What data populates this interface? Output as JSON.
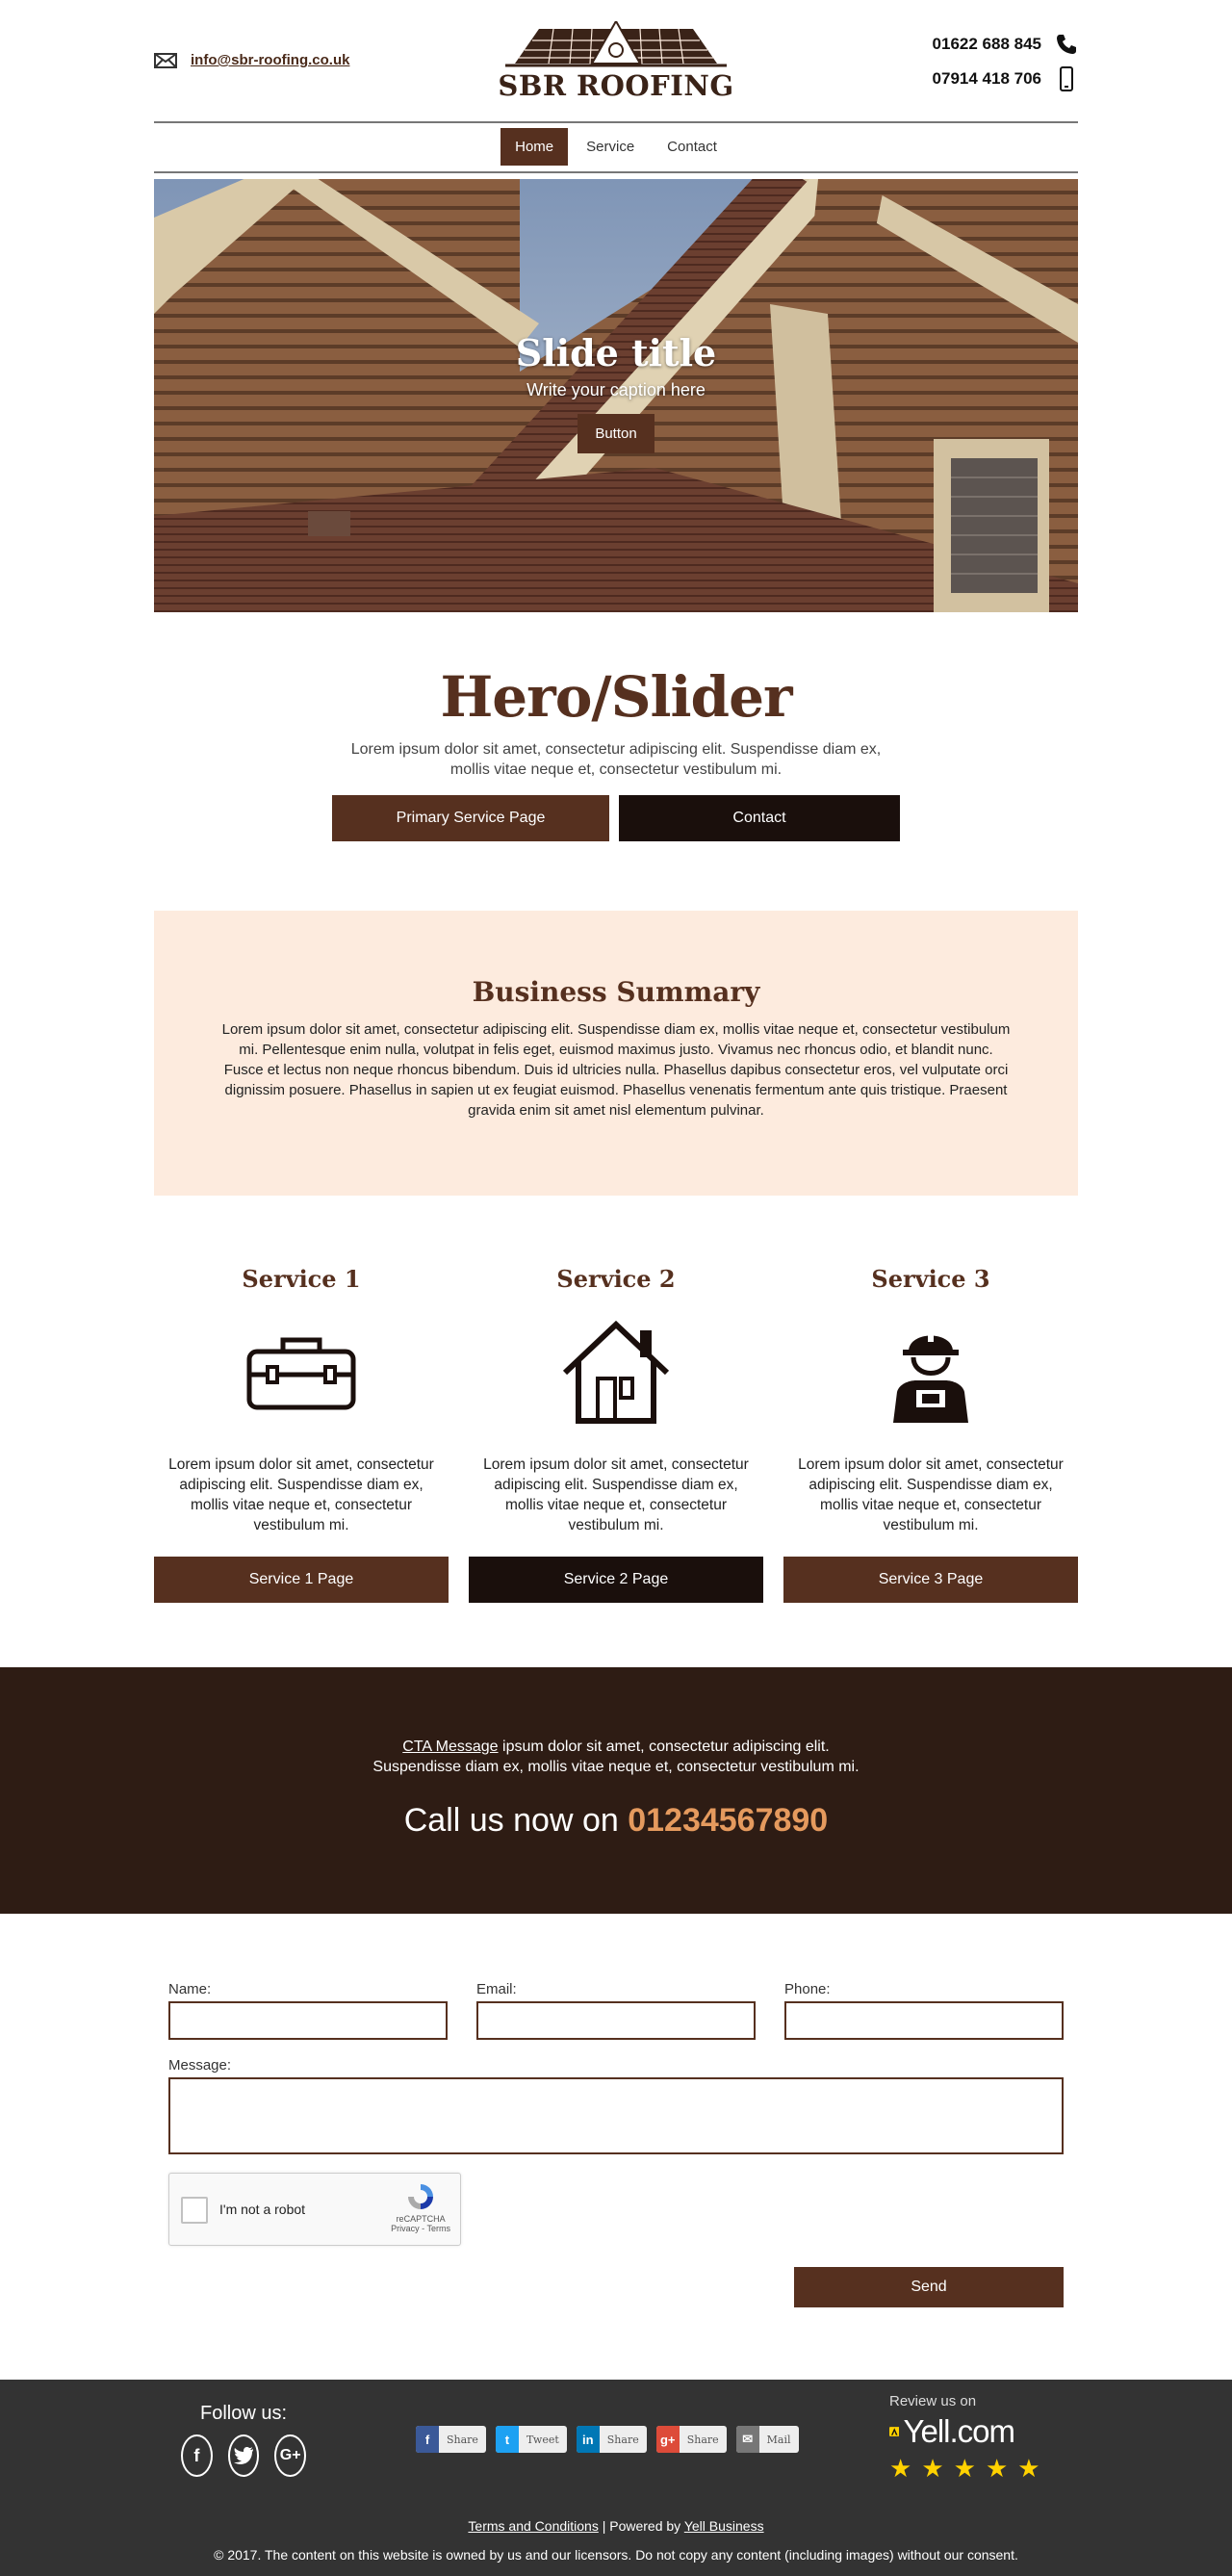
{
  "header": {
    "email": "info@sbr-roofing.co.uk",
    "logo_text": "SBR ROOFING",
    "phone_1": "01622 688 845",
    "phone_2": "07914 418 706"
  },
  "nav": {
    "items": [
      "Home",
      "Service",
      "Contact"
    ]
  },
  "slider": {
    "title": "Slide title",
    "caption": "Write your caption here",
    "button": "Button"
  },
  "intro": {
    "title": "Hero/Slider",
    "text": "Lorem ipsum dolor sit amet, consectetur adipiscing elit. Suspendisse diam ex, mollis vitae neque et, consectetur vestibulum mi.",
    "primary_button": "Primary Service Page",
    "contact_button": "Contact"
  },
  "summary": {
    "title": "Business Summary",
    "text": "Lorem ipsum dolor sit amet, consectetur adipiscing elit. Suspendisse diam ex, mollis vitae neque et, consectetur vestibulum mi. Pellentesque enim nulla, volutpat in felis eget, euismod maximus justo. Vivamus nec rhoncus odio, et blandit nunc. Fusce et lectus non neque rhoncus bibendum. Duis id ultricies nulla. Phasellus dapibus consectetur eros, vel vulputate orci dignissim posuere. Phasellus in sapien ut ex feugiat euismod. Phasellus venenatis fermentum ante quis tristique. Praesent gravida enim sit amet nisl elementum pulvinar."
  },
  "services": [
    {
      "title": "Service 1",
      "icon": "toolbox-icon",
      "text": "Lorem ipsum dolor sit amet, consectetur adipiscing elit. Suspendisse diam ex, mollis vitae neque et, consectetur vestibulum mi.",
      "button": "Service 1 Page"
    },
    {
      "title": "Service 2",
      "icon": "house-icon",
      "text": "Lorem ipsum dolor sit amet, consectetur adipiscing elit. Suspendisse diam ex, mollis vitae neque et, consectetur vestibulum mi.",
      "button": "Service 2 Page"
    },
    {
      "title": "Service 3",
      "icon": "worker-icon",
      "text": "Lorem ipsum dolor sit amet, consectetur adipiscing elit. Suspendisse diam ex, mollis vitae neque et, consectetur vestibulum mi.",
      "button": "Service 3 Page"
    }
  ],
  "cta": {
    "link": "CTA Message",
    "line_1": " ipsum dolor sit amet, consectetur adipiscing elit.",
    "line_2": "Suspendisse diam ex, mollis vitae neque et, consectetur vestibulum mi.",
    "call_prefix": "Call us now on ",
    "call_number": "01234567890"
  },
  "form": {
    "name_label": "Name:",
    "email_label": "Email:",
    "phone_label": "Phone:",
    "message_label": "Message:",
    "captcha_label": "I'm not a robot",
    "captcha_brand": "reCAPTCHA",
    "captcha_terms": "Privacy - Terms",
    "send": "Send"
  },
  "footer": {
    "follow": "Follow us:",
    "shares": [
      {
        "glyph": "f",
        "label": "Share",
        "color": "#3b5998"
      },
      {
        "glyph": "t",
        "label": "Tweet",
        "color": "#1da1f2"
      },
      {
        "glyph": "in",
        "label": "Share",
        "color": "#0077b5"
      },
      {
        "glyph": "g+",
        "label": "Share",
        "color": "#dd4b39"
      },
      {
        "glyph": "✉",
        "label": "Mail",
        "color": "#777777"
      }
    ],
    "review": "Review us on",
    "yell": "Yell.com",
    "terms": "Terms and Conditions",
    "powered_prefix": " | Powered by ",
    "powered": "Yell Business",
    "copyright": "© 2017. The content on this website is owned by us and our licensors. Do not copy any content (including images) without our consent."
  },
  "colors": {
    "brand_brown": "#56301f",
    "dark": "#1a0f0c",
    "summary_bg": "#fdebde",
    "accent_orange": "#e59a5e"
  }
}
